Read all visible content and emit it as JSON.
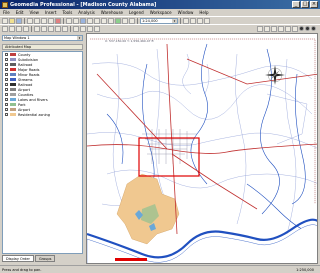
{
  "window": {
    "title": "Geomedia Professional - [Madison County Alabama]",
    "controls": [
      "_",
      "□",
      "×"
    ]
  },
  "menu": [
    "File",
    "Edit",
    "View",
    "Insert",
    "Tools",
    "Analysis",
    "Warehouse",
    "Legend",
    "Workspace",
    "Window",
    "Help"
  ],
  "toolbar": {
    "map_scale_value": "1:24,000"
  },
  "left_panel": {
    "map_window_selector": "Map Window 1",
    "legend_header": "Attributed Map",
    "layers": [
      {
        "label": "County",
        "color": "#c04040"
      },
      {
        "label": "Subdivision",
        "color": "#9090c0"
      },
      {
        "label": "Railroad",
        "color": "#606060"
      },
      {
        "label": "Major Roads",
        "color": "#d03030"
      },
      {
        "label": "Minor Roads",
        "color": "#6080c0"
      },
      {
        "label": "Streams",
        "color": "#4060c0"
      },
      {
        "label": "Railroad",
        "color": "#303030"
      },
      {
        "label": "Airport",
        "color": "#808080"
      },
      {
        "label": "Counties",
        "color": "#a0a0a0"
      },
      {
        "label": "Lakes and Rivers",
        "color": "#6aa8d8"
      },
      {
        "label": "Park",
        "color": "#90c090"
      },
      {
        "label": "Airport",
        "color": "#c0a080"
      },
      {
        "label": "Residential zoning",
        "color": "#f0c890"
      }
    ],
    "tabs": [
      "Display Order",
      "Groups"
    ]
  },
  "map": {
    "coordinate_readout": "X: 537,150.00 Y: 1,556,460.47 ft"
  },
  "status": {
    "left": "Press and drag to pan.",
    "right": "1:250,000"
  },
  "colors": {
    "title_bar": "#0a246a",
    "selection_box": "#e00000",
    "scale_bar": "#e00000",
    "water": "#2050c0",
    "major_road": "#c03030",
    "land_use": "#f0c890"
  }
}
